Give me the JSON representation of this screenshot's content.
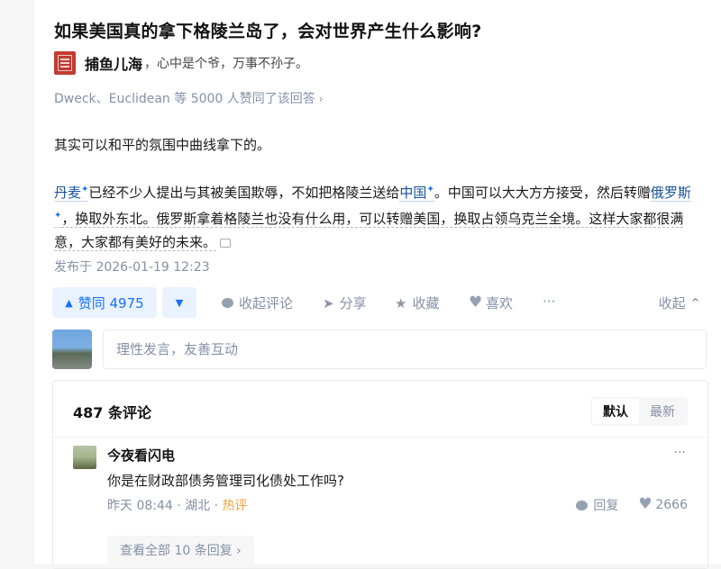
{
  "question": {
    "title": "如果美国真的拿下格陵兰岛了，会对世界产生什么影响?"
  },
  "author": {
    "name": "捕鱼儿海",
    "bio": "，心中是个爷，万事不孙子。"
  },
  "voters": {
    "text": "Dweck、Euclidean 等 5000 人赞同了该回答",
    "chevron": "›"
  },
  "answer": {
    "p1": "其实可以和平的氛围中曲线拿下的。",
    "p2": {
      "link1": "丹麦",
      "t1": "已经不少人提出与其被美国欺辱，不如把格陵兰送给",
      "link2": "中国",
      "t2": "。中国可以大大方方接受，然后转赠",
      "link3": "俄罗斯",
      "t3": "，换取外东北。俄罗斯拿着格陵兰也没有什么用，可以转赠美国，换取占领乌克兰全境。这样大家都很满意，大家都有美好的未来。"
    },
    "published": "发布于 2026-01-19 12:23"
  },
  "actions": {
    "vote_label": "赞同 4975",
    "vote_up_glyph": "▲",
    "vote_down_glyph": "▼",
    "collapse_comments": "收起评论",
    "share": "分享",
    "favorite": "收藏",
    "like": "喜欢",
    "more": "···",
    "collapse": "收起",
    "collapse_glyph": "⌃"
  },
  "comment_input": {
    "placeholder": "理性发言，友善互动"
  },
  "comments": {
    "count_label": "487 条评论",
    "sort": {
      "default": "默认",
      "latest": "最新"
    },
    "items": [
      {
        "user": "今夜看闪电",
        "text": "你是在财政部债务管理司化债处工作吗?",
        "time": "昨天 08:44",
        "location": "湖北",
        "badge": "热评",
        "reply": "回复",
        "likes": "2666",
        "more": "···"
      }
    ],
    "view_all": "查看全部 10 条回复 ›"
  },
  "icons": [
    "seal-avatar",
    "spark-icon",
    "comment-bubble-icon",
    "share-icon",
    "star-icon",
    "heart-icon",
    "more-icon",
    "chevron-up-icon",
    "reply-bubble-icon"
  ],
  "colors": {
    "accent": "#1772f6",
    "link": "#175199",
    "meta": "#8590a6",
    "hot": "#f1a23b",
    "seal": "#c23a32"
  }
}
